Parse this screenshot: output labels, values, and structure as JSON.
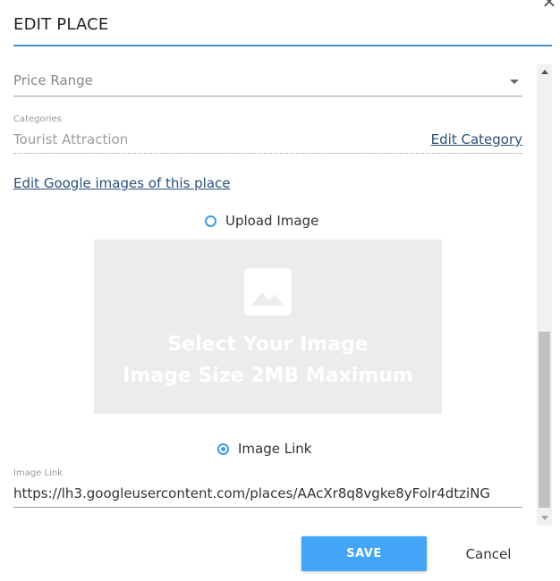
{
  "dialog": {
    "title": "EDIT PLACE",
    "close_glyph": "×"
  },
  "price_range": {
    "placeholder": "Price Range"
  },
  "categories": {
    "label": "Categories",
    "value": "Tourist Attraction",
    "edit_link": "Edit Category"
  },
  "google_images_link": "Edit Google images of this place",
  "upload": {
    "radio_label": "Upload Image",
    "selected": false,
    "line1": "Select Your Image",
    "line2": "Image Size 2MB Maximum",
    "icon": "image-icon"
  },
  "image_link": {
    "radio_label": "Image Link",
    "selected": true,
    "field_label": "Image Link",
    "value": "https://lh3.googleusercontent.com/places/AAcXr8q8vgke8yFolr4dtziNG"
  },
  "actions": {
    "save": "SAVE",
    "cancel": "Cancel"
  },
  "colors": {
    "accent": "#42a5f5",
    "title_rule": "#4a90c8",
    "link": "#2a4f7a",
    "upload_bg": "#ececec"
  }
}
